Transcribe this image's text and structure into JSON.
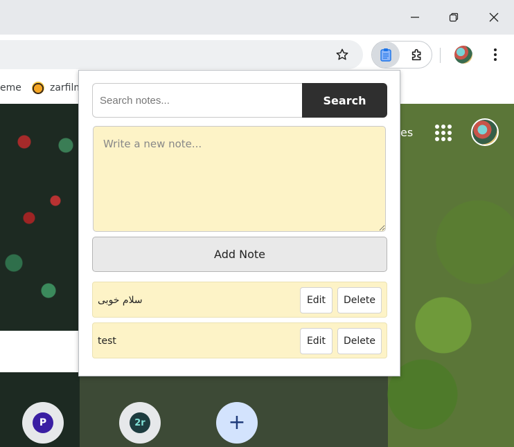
{
  "bookmarks": {
    "items": [
      {
        "label": "eme"
      },
      {
        "label": "zarfilm"
      }
    ]
  },
  "page": {
    "top_right_link": "es",
    "shortcut_1_letter": "P",
    "shortcut_2_letter": "2r"
  },
  "popup": {
    "search_placeholder": "Search notes...",
    "search_button": "Search",
    "note_placeholder": "Write a new note...",
    "add_button": "Add Note",
    "notes": [
      {
        "text": "سلام خوبی",
        "edit": "Edit",
        "delete": "Delete"
      },
      {
        "text": "test",
        "edit": "Edit",
        "delete": "Delete"
      }
    ]
  },
  "colors": {
    "note_bg": "#fdf3c7",
    "search_button_bg": "#2f2f2f",
    "add_button_bg": "#e9e9e9"
  }
}
